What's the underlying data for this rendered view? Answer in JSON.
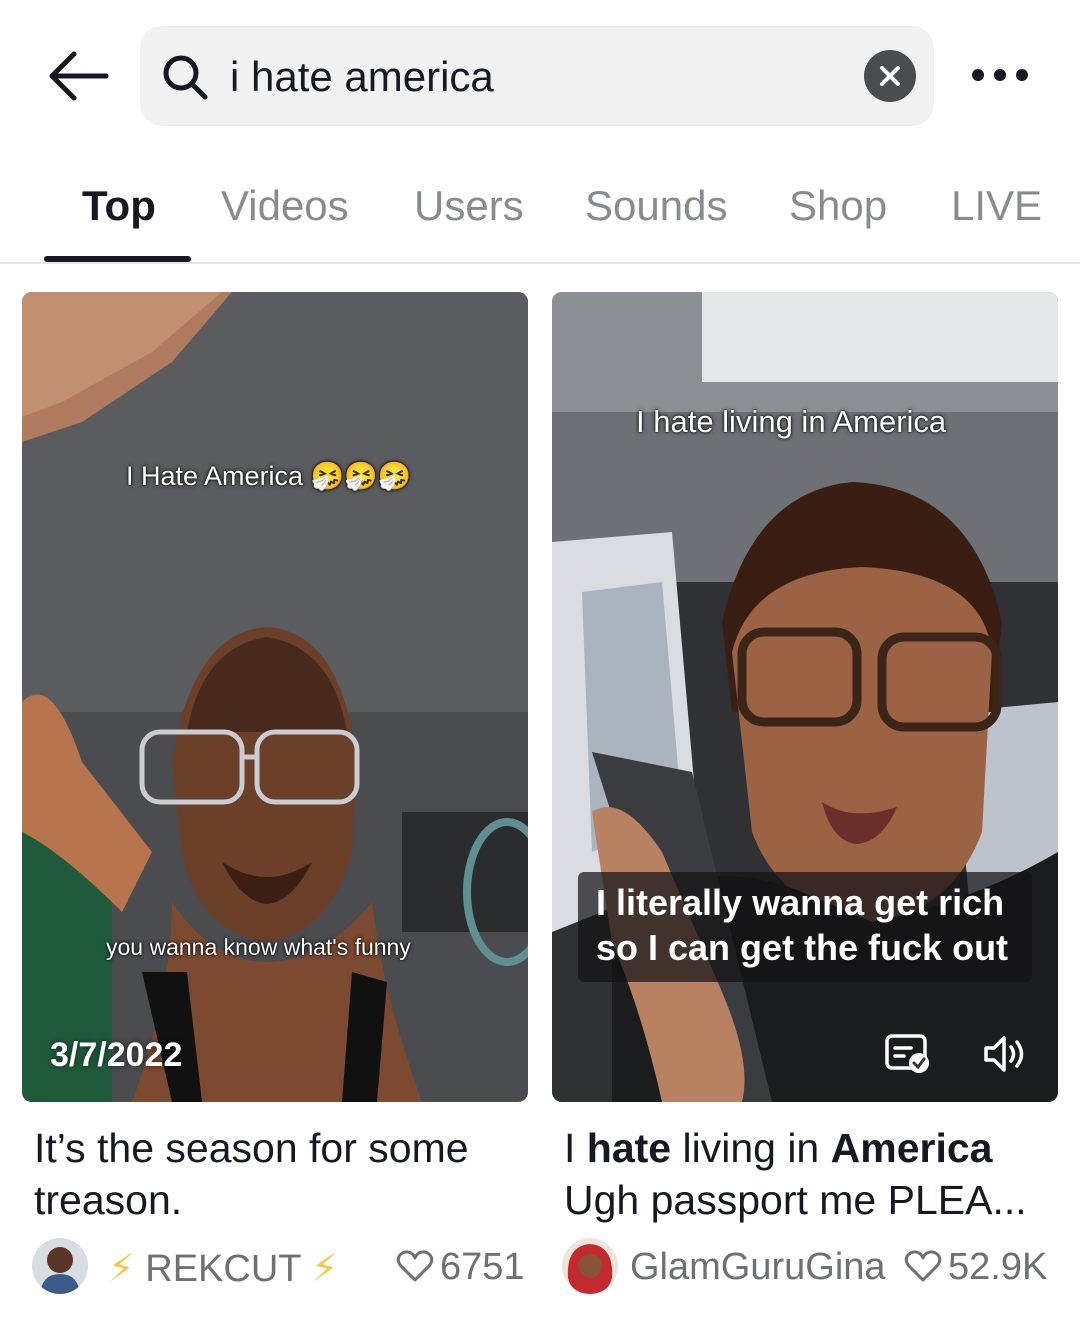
{
  "search": {
    "query": "i hate america"
  },
  "tabs": [
    {
      "label": "Top",
      "active": true
    },
    {
      "label": "Videos",
      "active": false
    },
    {
      "label": "Users",
      "active": false
    },
    {
      "label": "Sounds",
      "active": false
    },
    {
      "label": "Shop",
      "active": false
    },
    {
      "label": "LIVE",
      "active": false
    }
  ],
  "results": [
    {
      "overlay_top": "I Hate America 🤧🤧🤧",
      "overlay_bottom": "you wanna know what's funny",
      "date": "3/7/2022",
      "title": "It’s the season for some treason.",
      "author": "REKCUT",
      "author_decoration": "⚡",
      "likes": "6751"
    },
    {
      "overlay_top": "I hate living in America",
      "caption_lines": [
        "I literally wanna get rich",
        "so I can get the fuck out"
      ],
      "title_parts": [
        "I ",
        "hate",
        " living in ",
        "America"
      ],
      "title_line2": "Ugh passport me PLEA...",
      "author": "GlamGuruGina",
      "likes": "52.9K"
    }
  ],
  "icons": {
    "back": "arrow-left-icon",
    "search": "search-icon",
    "clear": "close-icon",
    "more": "more-dots-icon",
    "captions": "captions-icon",
    "sound": "speaker-icon",
    "like": "heart-outline-icon"
  },
  "colors": {
    "text": "#161823",
    "muted": "#8a8b91",
    "search_bg": "#f1f1f2",
    "bolt": "#f5c84a"
  }
}
